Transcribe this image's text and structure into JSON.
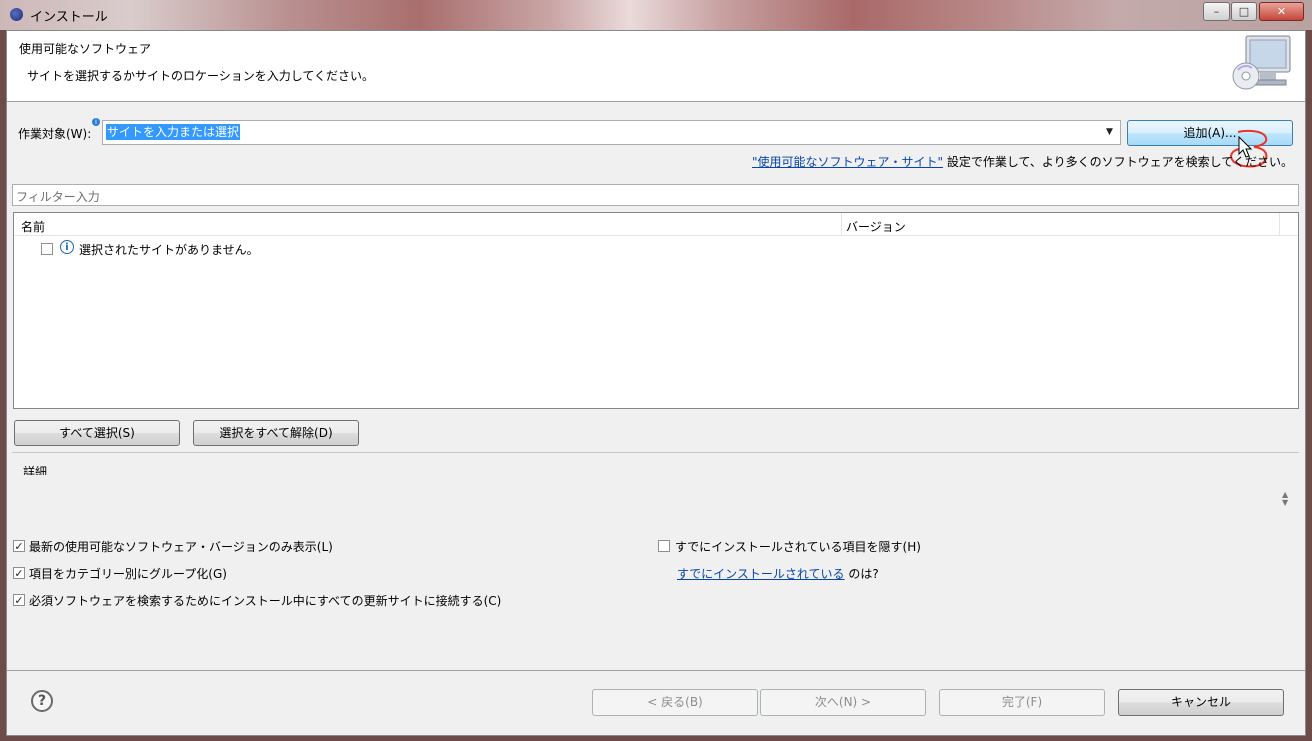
{
  "window": {
    "title": "インストール",
    "minimize": "–",
    "maximize": "□",
    "close": "✕"
  },
  "header": {
    "title": "使用可能なソフトウェア",
    "description": "サイトを選択するかサイトのロケーションを入力してください。"
  },
  "work_with": {
    "label": "作業対象(W):",
    "value": "サイトを入力または選択",
    "add_button": "追加(A)..."
  },
  "sites_hint": {
    "link": "\"使用可能なソフトウェア・サイト\"",
    "text": " 設定で作業して、より多くのソフトウェアを検索してください。"
  },
  "filter": {
    "placeholder": "フィルター入力"
  },
  "table": {
    "columns": [
      "名前",
      "バージョン"
    ],
    "rows": [
      {
        "name": "選択されたサイトがありません。",
        "version": ""
      }
    ]
  },
  "buttons": {
    "select_all": "すべて選択(S)",
    "deselect_all": "選択をすべて解除(D)"
  },
  "details": {
    "label": "詳細"
  },
  "options": {
    "latest_only": {
      "label": "最新の使用可能なソフトウェア・バージョンのみ表示(L)",
      "checked": true
    },
    "group_by_category": {
      "label": "項目をカテゴリー別にグループ化(G)",
      "checked": true
    },
    "contact_all_sites": {
      "label": "必須ソフトウェアを検索するためにインストール中にすべての更新サイトに接続する(C)",
      "checked": true
    },
    "hide_installed": {
      "label": "すでにインストールされている項目を隠す(H)",
      "checked": false
    },
    "already_installed_link": "すでにインストールされている",
    "already_installed_suffix": " のは?"
  },
  "footer": {
    "help": "?",
    "back": "< 戻る(B)",
    "next": "次へ(N) >",
    "finish": "完了(F)",
    "cancel": "キャンセル"
  },
  "colors": {
    "selection": "#3399ff",
    "link": "#0645ad",
    "annotation": "#e8342a"
  }
}
